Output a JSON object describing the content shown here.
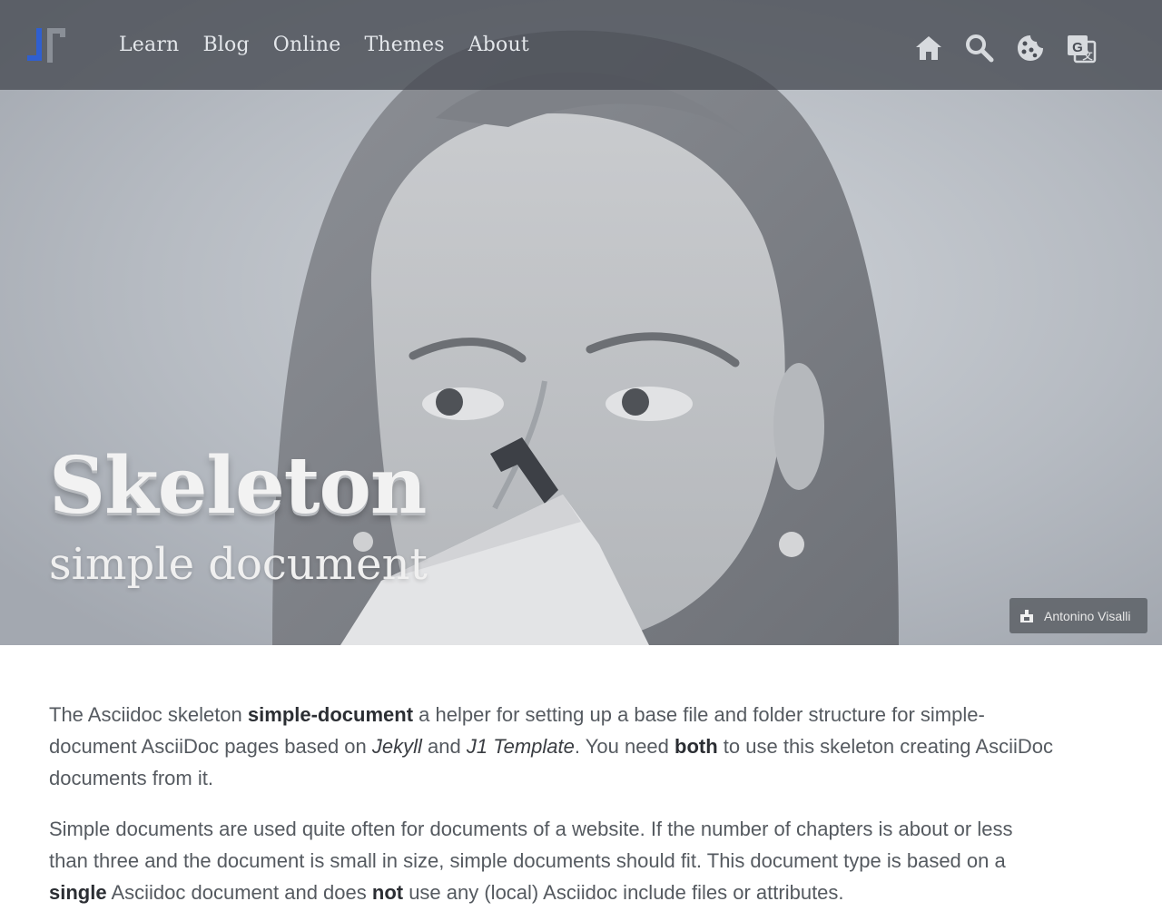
{
  "navbar": {
    "brand_name": "J1",
    "links": [
      {
        "label": "Learn"
      },
      {
        "label": "Blog"
      },
      {
        "label": "Online"
      },
      {
        "label": "Themes"
      },
      {
        "label": "About"
      }
    ],
    "icons": [
      "home-icon",
      "search-icon",
      "cookie-icon",
      "translate-icon"
    ],
    "background": "#4a4e56"
  },
  "hero": {
    "title": "Skeleton",
    "subtitle": "simple document",
    "credit": "Antonino Visalli",
    "credit_icon": "camera-icon"
  },
  "content": {
    "p1": [
      "The Asciidoc skeleton ",
      "simple-document",
      " a helper for setting up a base file and folder structure for simple-",
      "document AsciiDoc pages based on ",
      "Jekyll",
      " and ",
      "J1 Template",
      ". You need ",
      "both",
      " to use this skeleton creating AsciiDoc",
      "documents from it."
    ],
    "p2": [
      "Simple documents are used quite often for documents of a website. If the number of chapters is about or less",
      "than three and the document is small in size, simple documents should fit. This document type is based on a",
      "single",
      " Asciidoc document and does ",
      "not",
      " use any (local) Asciidoc include files or attributes."
    ]
  },
  "colors": {
    "brand_blue": "#2f5fd0",
    "brand_gray": "#8a8f97",
    "text": "#555a60"
  }
}
